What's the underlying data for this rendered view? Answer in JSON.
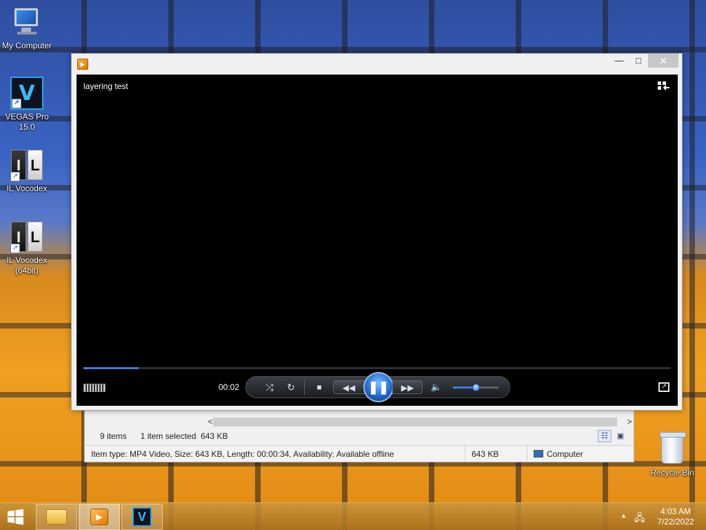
{
  "desktop": {
    "icons": [
      {
        "label": "My Computer"
      },
      {
        "label": "VEGAS Pro\n15.0",
        "glyph": "V"
      },
      {
        "label": "IL Vocodex",
        "glyph_left": "I",
        "glyph_right": "L"
      },
      {
        "label": "IL Vocodex\n(64bit)",
        "glyph_left": "I",
        "glyph_right": "L"
      }
    ],
    "recycle_bin": {
      "label": "Recycle Bin"
    }
  },
  "explorer": {
    "scroll_left": "<",
    "scroll_right": ">",
    "item_count": "9 items",
    "selection": "1 item selected",
    "selection_size": "643 KB",
    "details": "Item type: MP4 Video, Size: 643 KB, Length: 00:00:34, Availability: Available offline",
    "details_size": "643 KB",
    "location": "Computer"
  },
  "player": {
    "title": "layering test",
    "window_controls": {
      "minimize": "—",
      "maximize": "□",
      "close": "✕"
    },
    "elapsed": "00:02",
    "progress_fraction": 0.094,
    "volume_fraction": 0.5,
    "state": "playing",
    "controls": {
      "shuffle": "⤮",
      "repeat": "↻",
      "stop": "■",
      "previous": "◀◀",
      "pause": "❚❚",
      "next": "▶▶",
      "mute": "🔈"
    }
  },
  "taskbar": {
    "clock_time": "4:03 AM",
    "clock_date": "7/22/2022",
    "vegas_glyph": "V",
    "wmp_glyph": "▶"
  },
  "colors": {
    "accent": "#3f7fd8",
    "video_bg": "#000000",
    "close_button": "#c7c7c7"
  }
}
